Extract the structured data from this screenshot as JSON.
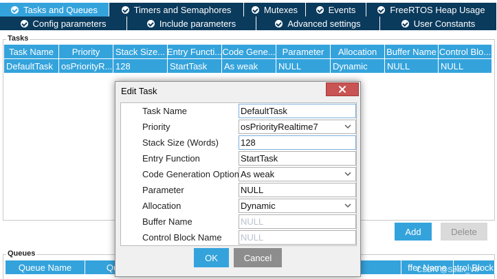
{
  "tabs_row1": [
    {
      "label": "Tasks and Queues",
      "active": true
    },
    {
      "label": "Timers and Semaphores",
      "active": false
    },
    {
      "label": "Mutexes",
      "active": false
    },
    {
      "label": "Events",
      "active": false
    },
    {
      "label": "FreeRTOS Heap Usage",
      "active": false
    }
  ],
  "tabs_row2": [
    {
      "label": "Config parameters"
    },
    {
      "label": "Include parameters"
    },
    {
      "label": "Advanced settings"
    },
    {
      "label": "User Constants"
    }
  ],
  "tasks": {
    "title": "Tasks",
    "columns": [
      "Task Name",
      "Priority",
      "Stack Size...",
      "Entry Functi...",
      "Code Gene...",
      "Parameter",
      "Allocation",
      "Buffer Name",
      "Control Blo..."
    ],
    "rows": [
      [
        "DefaultTask",
        "osPriorityR...",
        "128",
        "StartTask",
        "As weak",
        "NULL",
        "Dynamic",
        "NULL",
        "NULL"
      ]
    ],
    "add_label": "Add",
    "delete_label": "Delete"
  },
  "queues": {
    "title": "Queues",
    "columns": [
      "Queue Name",
      "Qu",
      "",
      "",
      "ffer Name",
      "Control Block Na"
    ]
  },
  "dialog": {
    "title": "Edit Task",
    "fields": [
      {
        "label": "Task Name",
        "value": "DefaultTask",
        "type": "text",
        "focused": true
      },
      {
        "label": "Priority",
        "value": "osPriorityRealtime7",
        "type": "select"
      },
      {
        "label": "Stack Size (Words)",
        "value": "128",
        "type": "text"
      },
      {
        "label": "Entry Function",
        "value": "StartTask",
        "type": "text"
      },
      {
        "label": "Code Generation Option",
        "value": "As weak",
        "type": "select"
      },
      {
        "label": "Parameter",
        "value": "NULL",
        "type": "text"
      },
      {
        "label": "Allocation",
        "value": "Dynamic",
        "type": "select"
      },
      {
        "label": "Buffer Name",
        "placeholder": "NULL",
        "type": "text"
      },
      {
        "label": "Control Block Name",
        "placeholder": "NULL",
        "type": "text"
      }
    ],
    "ok_label": "OK",
    "cancel_label": "Cancel"
  },
  "watermark": "CSDN @Sean_VIP",
  "colors": {
    "tab_dark": "#0a3a5c",
    "accent": "#34a3dc",
    "close_red": "#c95454"
  }
}
